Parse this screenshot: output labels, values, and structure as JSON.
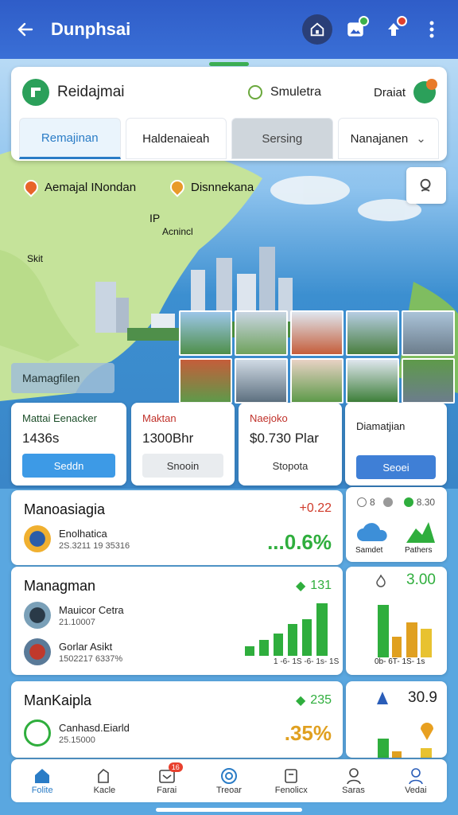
{
  "appbar": {
    "title": "Dunphsai"
  },
  "header": {
    "brand": "Reidajmai",
    "sim_label": "Smuletra",
    "dropdown_label": "Draiat",
    "tabs": [
      "Remajinan",
      "Haldenaieah",
      "Sersing",
      "Nanajanen"
    ]
  },
  "map": {
    "pin1": "Aemajal INondan",
    "pin2": "Disnnekana",
    "label_ip": "IP",
    "label_acnl": "Acnincl",
    "label_skit": "Skit",
    "chip": "Mamagfilen"
  },
  "stats": [
    {
      "label": "Mattai Eenacker",
      "value": "1436s",
      "button": "Seddn"
    },
    {
      "label": "Maktan",
      "value": "1300Bhr",
      "button": "Snooin"
    },
    {
      "label": "Naejoko",
      "value": "$0.730 Plar",
      "button": "Stopota"
    },
    {
      "label": "Diamatjian",
      "value": "",
      "button": "Seoei"
    }
  ],
  "panel1": {
    "title": "Manoasiagia",
    "right": "+0.22",
    "row_name": "Enolhatica",
    "row_sub": "2S.3211 19 35316",
    "pct": "...0.6%"
  },
  "panel2": {
    "title": "Managman",
    "right": "131",
    "rows": [
      {
        "name": "Mauicor Cetra",
        "sub": "21.10007"
      },
      {
        "name": "Gorlar Asikt",
        "sub": "1502217 6337%"
      }
    ],
    "xaxis": "1 -6- 1S -6- 1s- 1S"
  },
  "panel3": {
    "title": "ManKaipla",
    "right": "235",
    "row_name": "Canhasd.Eiarld",
    "row_sub": "25.15000",
    "pct": ".35%"
  },
  "side1": {
    "label_a": "8",
    "label_b": "8.30",
    "col_a": "Samdet",
    "col_b": "Pathers"
  },
  "side2": {
    "value": "3.00",
    "xaxis": "0b- 6T- 1S- 1s"
  },
  "side3": {
    "value": "30.9"
  },
  "nav": [
    {
      "label": "Folite"
    },
    {
      "label": "Kacle"
    },
    {
      "label": "Farai",
      "badge": "16"
    },
    {
      "label": "Treoar"
    },
    {
      "label": "Fenolicx"
    },
    {
      "label": "Saras"
    },
    {
      "label": "Vedai"
    }
  ]
}
